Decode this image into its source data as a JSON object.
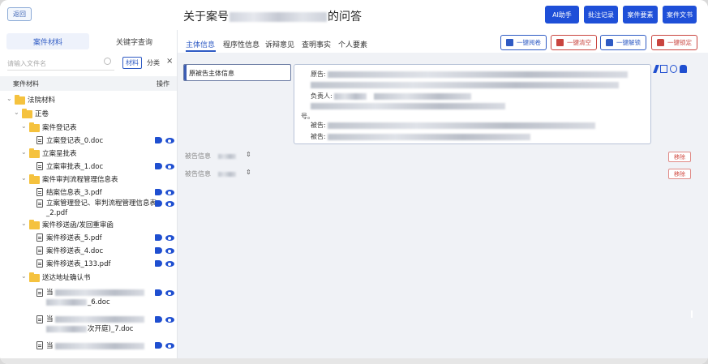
{
  "header": {
    "back_label": "返回",
    "title_prefix": "关于案号",
    "title_suffix": "的问答",
    "buttons": [
      {
        "label": "AI助手"
      },
      {
        "label": "批注记录"
      },
      {
        "label": "案件要素"
      },
      {
        "label": "案件文书"
      }
    ]
  },
  "left": {
    "tabs": [
      "案件材料",
      "关键字查询"
    ],
    "search_placeholder": "请输入文件名",
    "seg_material": "材料",
    "seg_category": "分类",
    "collapse_icon": "×",
    "col_name": "案件材料",
    "col_action": "操作",
    "tree": [
      {
        "level": 0,
        "kind": "folder",
        "label": "法院材料",
        "expanded": true,
        "icons": false
      },
      {
        "level": 1,
        "kind": "folder",
        "label": "正卷",
        "expanded": true,
        "icons": false
      },
      {
        "level": 2,
        "kind": "folder",
        "label": "案件登记表",
        "expanded": true,
        "icons": false
      },
      {
        "level": 3,
        "kind": "doc",
        "label": "立案登记表_0.doc",
        "icons": true
      },
      {
        "level": 2,
        "kind": "folder",
        "label": "立案呈批表",
        "expanded": true,
        "icons": false
      },
      {
        "level": 3,
        "kind": "doc",
        "label": "立案审批表_1.doc",
        "icons": true
      },
      {
        "level": 2,
        "kind": "folder",
        "label": "案件审判流程管理信息表",
        "expanded": true,
        "icons": false
      },
      {
        "level": 3,
        "kind": "doc",
        "label": "结案信息表_3.pdf",
        "icons": true
      },
      {
        "level": 3,
        "kind": "doc",
        "label": "立案管理登记、审判流程管理信息表",
        "label2": "_2.pdf",
        "icons": true
      },
      {
        "level": 2,
        "kind": "folder",
        "label": "案件移送函/发回重审函",
        "expanded": true,
        "icons": false
      },
      {
        "level": 3,
        "kind": "doc",
        "label": "案件移送表_5.pdf",
        "icons": true
      },
      {
        "level": 3,
        "kind": "doc",
        "label": "案件移送表_4.doc",
        "icons": true
      },
      {
        "level": 3,
        "kind": "doc",
        "label": "案件移送表_133.pdf",
        "icons": true
      },
      {
        "level": 2,
        "kind": "folder",
        "label": "送达地址确认书",
        "expanded": true,
        "icons": false
      },
      {
        "level": 3,
        "kind": "doc",
        "label": "当",
        "label2": "_6.doc",
        "blurred": true,
        "icons": true
      },
      {
        "level": 3,
        "kind": "doc",
        "label": "当",
        "label2": "次开庭)_7.doc",
        "blurred": true,
        "icons": true
      },
      {
        "level": 3,
        "kind": "doc",
        "label": "当",
        "blurred": true,
        "icons": true
      }
    ]
  },
  "main": {
    "tabs": [
      "主体信息",
      "程序性信息",
      "诉辩意见",
      "查明事实",
      "个人要素"
    ],
    "active_tab": 0,
    "actions": [
      {
        "label": "一键阅卷",
        "tone": "blue"
      },
      {
        "label": "一键清空",
        "tone": "red"
      },
      {
        "label": "一键解锁",
        "tone": "blue"
      },
      {
        "label": "一键锁定",
        "tone": "red"
      }
    ],
    "party_button": "原被告主体信息",
    "info_fields": [
      {
        "label": "原告:"
      },
      {
        "label": "负责人:"
      },
      {
        "label": "号。"
      },
      {
        "label": "被告:"
      },
      {
        "label": "被告:"
      }
    ],
    "defendant_rows": [
      {
        "label": "被告信息",
        "remove": "移除"
      },
      {
        "label": "被告信息",
        "remove": "移除"
      }
    ]
  },
  "colors": {
    "primary": "#1e4fd8",
    "danger": "#c9453f",
    "folder": "#f5c23e"
  }
}
